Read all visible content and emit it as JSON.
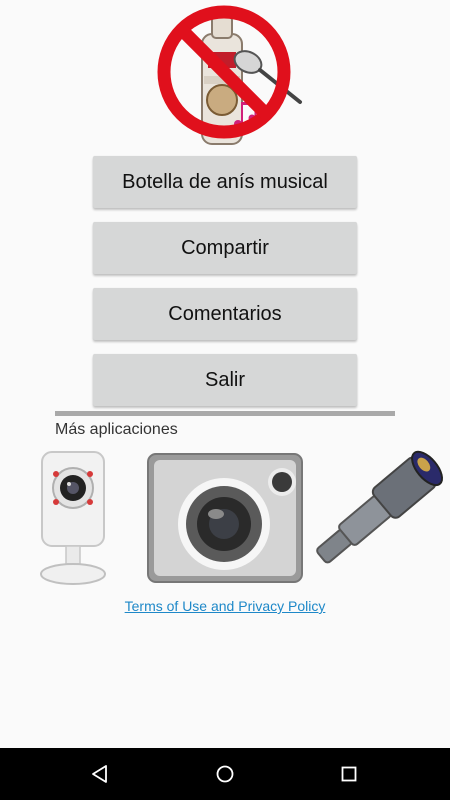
{
  "buttons": {
    "musical": "Botella de anís musical",
    "share": "Compartir",
    "comments": "Comentarios",
    "exit": "Salir"
  },
  "more_apps": {
    "title": "Más aplicaciones",
    "items": [
      {
        "icon": "security-camera-icon"
      },
      {
        "icon": "camera-icon"
      },
      {
        "icon": "telescope-icon"
      }
    ]
  },
  "links": {
    "terms": "Terms of Use and Privacy Policy"
  },
  "navbar": {
    "back_icon": "back-triangle-icon",
    "home_icon": "home-circle-icon",
    "recents_icon": "recents-square-icon"
  },
  "colors": {
    "button_bg": "#d6d7d7",
    "link": "#1e88c8",
    "prohibition_red": "#e0101c",
    "navbar": "#000000"
  }
}
